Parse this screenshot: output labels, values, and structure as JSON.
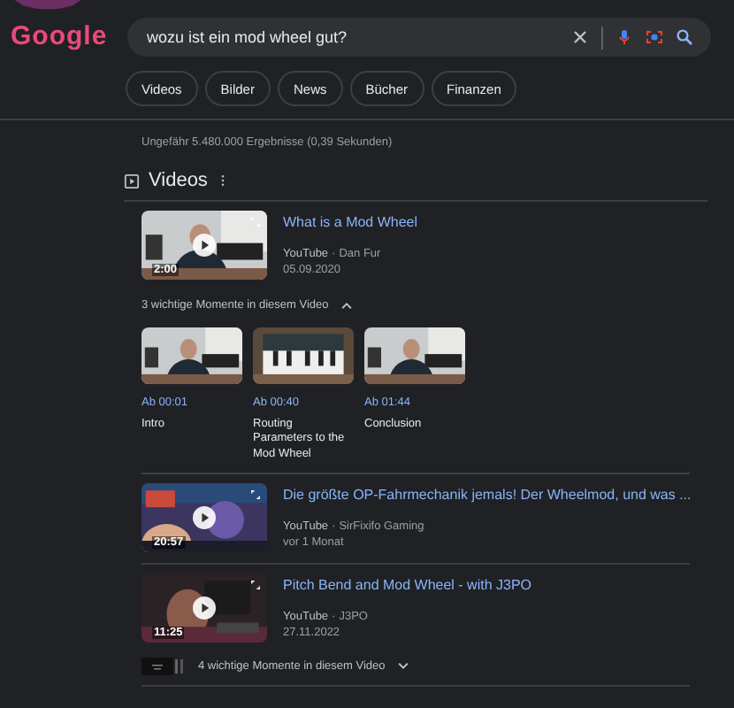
{
  "logo": {
    "text": "Google"
  },
  "search": {
    "value": "wozu ist ein mod wheel gut?"
  },
  "chips": [
    {
      "label": "Videos"
    },
    {
      "label": "Bilder"
    },
    {
      "label": "News"
    },
    {
      "label": "Bücher"
    },
    {
      "label": "Finanzen"
    }
  ],
  "result_stats": "Ungefähr 5.480.000 Ergebnisse (0,39 Sekunden)",
  "videos_section": {
    "title": "Videos",
    "results": [
      {
        "title": "What is a Mod Wheel",
        "duration": "2:00",
        "source": "YouTube",
        "separator": "·",
        "channel": "Dan Fur",
        "date": "05.09.2020",
        "moments": {
          "label": "3 wichtige Momente in diesem Video",
          "expanded": true,
          "items": [
            {
              "time": "Ab 00:01",
              "title": "Intro"
            },
            {
              "time": "Ab 00:40",
              "title": "Routing Parameters to the Mod Wheel"
            },
            {
              "time": "Ab 01:44",
              "title": "Conclusion"
            }
          ]
        }
      },
      {
        "title": "Die größte OP-Fahrmechanik jemals! Der Wheelmod, und was ...",
        "duration": "20:57",
        "source": "YouTube",
        "separator": "·",
        "channel": "SirFixifo Gaming",
        "date": "vor 1 Monat"
      },
      {
        "title": "Pitch Bend and Mod Wheel - with J3PO",
        "duration": "11:25",
        "source": "YouTube",
        "separator": "·",
        "channel": "J3PO",
        "date": "27.11.2022",
        "moments": {
          "label": "4 wichtige Momente in diesem Video",
          "expanded": false
        }
      }
    ]
  }
}
